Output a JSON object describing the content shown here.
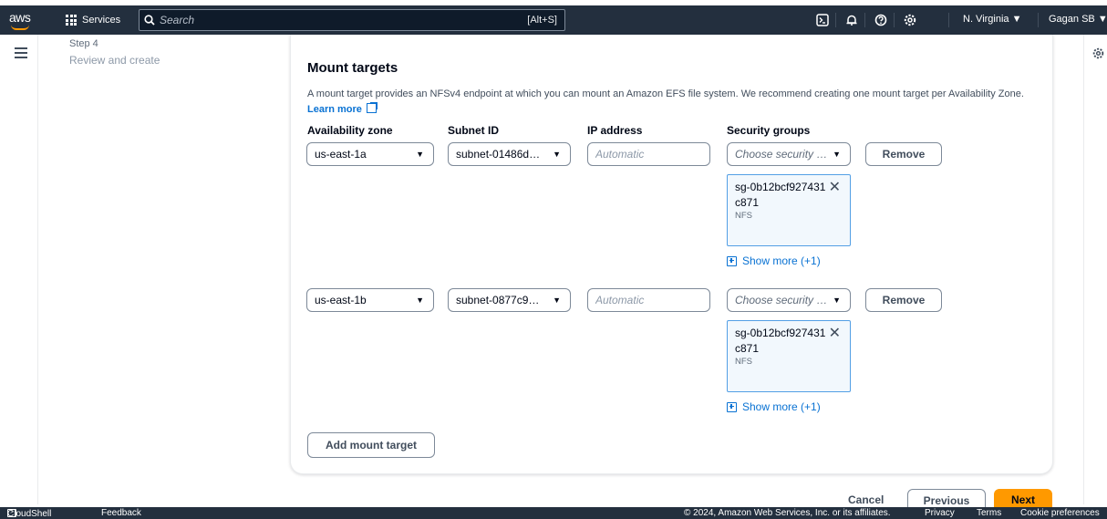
{
  "nav": {
    "logo": "aws",
    "services_label": "Services",
    "search_placeholder": "Search",
    "search_shortcut": "[Alt+S]",
    "region": "N. Virginia ▼",
    "user": "Gagan SB ▼",
    "icons": [
      "cloudshell-icon",
      "bell-icon",
      "help-icon",
      "settings-icon"
    ]
  },
  "steps": {
    "step_num": "Step 4",
    "step_name": "Review and create"
  },
  "mount_targets": {
    "title": "Mount targets",
    "description": "A mount target provides an NFSv4 endpoint at which you can mount an Amazon EFS file system. We recommend creating one mount target per Availability Zone.",
    "learn_more": "Learn more",
    "columns": {
      "az": "Availability zone",
      "subnet": "Subnet ID",
      "ip": "IP address",
      "sg": "Security groups"
    },
    "rows": [
      {
        "az": "us-east-1a",
        "subnet": "subnet-01486d…",
        "ip_placeholder": "Automatic",
        "sg_placeholder": "Choose security …",
        "remove": "Remove",
        "token_id": "sg-0b12bcf927431c871",
        "token_name": "NFS",
        "show_more": "Show more (+1)"
      },
      {
        "az": "us-east-1b",
        "subnet": "subnet-0877c9…",
        "ip_placeholder": "Automatic",
        "sg_placeholder": "Choose security …",
        "remove": "Remove",
        "token_id": "sg-0b12bcf927431c871",
        "token_name": "NFS",
        "show_more": "Show more (+1)"
      }
    ],
    "add_button": "Add mount target"
  },
  "actions": {
    "cancel": "Cancel",
    "previous": "Previous",
    "next": "Next"
  },
  "footer": {
    "cloudshell": "CloudShell",
    "feedback": "Feedback",
    "copyright": "© 2024, Amazon Web Services, Inc. or its affiliates.",
    "privacy": "Privacy",
    "terms": "Terms",
    "cookies": "Cookie preferences"
  },
  "colors": {
    "nav_bg": "#232f3e",
    "accent": "#ff9900",
    "link": "#0972d3"
  }
}
